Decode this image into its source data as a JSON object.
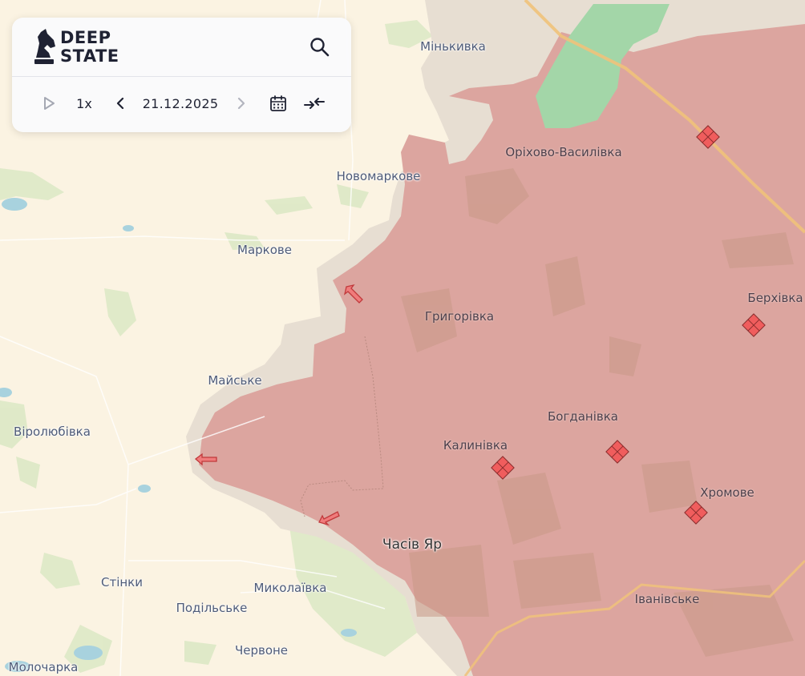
{
  "app": {
    "brand_line1": "DEEP",
    "brand_line2": "STATE",
    "search_icon": "search-icon"
  },
  "timeline": {
    "play_icon": "play-icon",
    "speed": "1x",
    "prev_icon": "chevron-left-icon",
    "date": "21.12.2025",
    "next_icon": "chevron-right-icon",
    "calendar_icon": "calendar-icon",
    "compare_icon": "compare-arrows-icon"
  },
  "colors": {
    "land": "#fbf3e2",
    "occupied": "#dca59f",
    "grey_zone": "#e7ded2",
    "forest": "#d7e7c2",
    "water": "#a8d2de",
    "reservoir": "#a3d6a8",
    "road": "#f0c27a",
    "marker": "#f05d5d",
    "label": "#4e5b78"
  },
  "places": {
    "minkivka": "Мінькивка",
    "orikhovo": "Оріхово-Василівка",
    "novomarkove": "Новомаркове",
    "markove": "Маркове",
    "hryhorivka": "Григорівка",
    "berkhivka": "Берхівка",
    "maiske": "Майське",
    "virolyubivka": "Віролюбівка",
    "bohdanivka": "Богданівка",
    "kalynivka": "Калинівка",
    "khromove": "Хромове",
    "chasiv_yar": "Часів Яр",
    "stinky": "Стінки",
    "mykolaivka": "Миколаївка",
    "podilske": "Подільське",
    "ivanivske": "Іванівське",
    "chervone": "Червоне",
    "molocharka": "Молочарка"
  },
  "map_legend_items": {
    "occupied_marker": "occupied-settlement-icon",
    "attack_arrow": "attack-direction-arrow-icon"
  }
}
